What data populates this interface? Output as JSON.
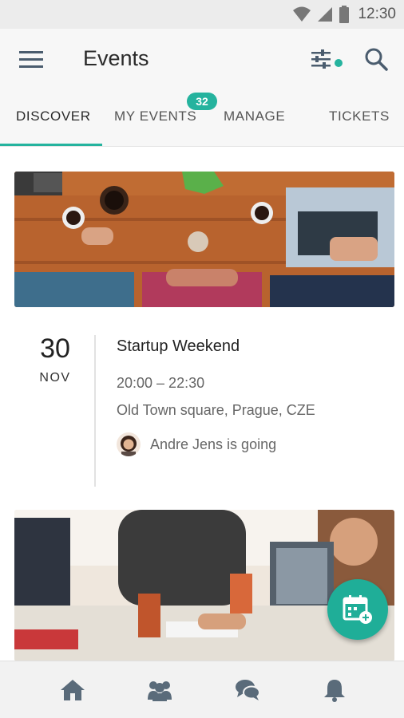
{
  "status_bar": {
    "time": "12:30",
    "icons": [
      "wifi-icon",
      "signal-icon",
      "battery-icon"
    ]
  },
  "app_bar": {
    "title": "Events",
    "menu_icon": "hamburger-menu-icon",
    "filter_icon": "filter-sliders-icon",
    "search_icon": "search-icon"
  },
  "tabs": [
    {
      "label": "DISCOVER",
      "active": true
    },
    {
      "label": "MY EVENTS",
      "badge": "32"
    },
    {
      "label": "MANAGE"
    },
    {
      "label": "TICKETS"
    }
  ],
  "event": {
    "day": "30",
    "month": "NOV",
    "title": "Startup Weekend",
    "time": "20:00 – 22:30",
    "location": "Old Town square, Prague, CZE",
    "attendee_text": "Andre Jens is going"
  },
  "fab": {
    "icon": "add-calendar-icon"
  },
  "bottom_nav": [
    {
      "icon": "home-icon"
    },
    {
      "icon": "people-icon"
    },
    {
      "icon": "chat-icon"
    },
    {
      "icon": "bell-icon"
    }
  ],
  "colors": {
    "accent": "#25b39e",
    "fab": "#1fae98",
    "icon_gray": "#5a6b7a"
  }
}
